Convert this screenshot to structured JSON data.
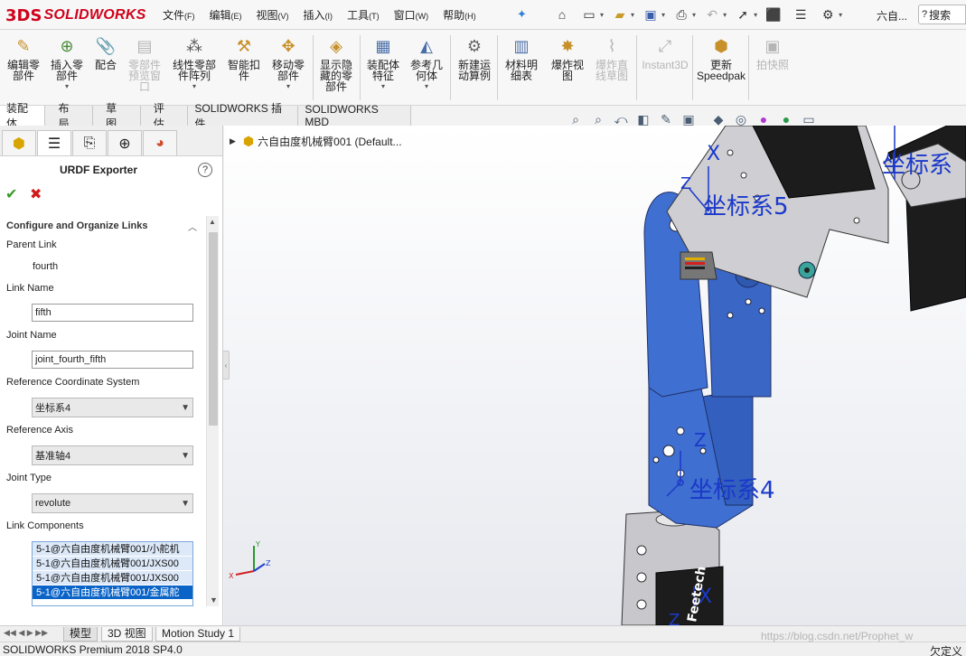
{
  "app": {
    "brand_mark": "3DS",
    "brand_name": "SOLIDWORKS",
    "document_title": "六自..."
  },
  "menus": [
    {
      "label": "文件",
      "key": "(F)"
    },
    {
      "label": "编辑",
      "key": "(E)"
    },
    {
      "label": "视图",
      "key": "(V)"
    },
    {
      "label": "插入",
      "key": "(I)"
    },
    {
      "label": "工具",
      "key": "(T)"
    },
    {
      "label": "窗口",
      "key": "(W)"
    },
    {
      "label": "帮助",
      "key": "(H)"
    }
  ],
  "search": {
    "label": "搜索"
  },
  "commands": [
    {
      "label": "编辑零\n部件",
      "icon": "edit-component-icon"
    },
    {
      "label": "插入零\n部件",
      "icon": "insert-component-icon"
    },
    {
      "label": "配合",
      "icon": "mate-icon"
    },
    {
      "label": "零部件\n预览窗\n口",
      "icon": "preview-window-icon"
    },
    {
      "label": "线性零部\n件阵列",
      "icon": "linear-pattern-icon"
    },
    {
      "label": "智能扣\n件",
      "icon": "smart-fastener-icon"
    },
    {
      "label": "移动零\n部件",
      "icon": "move-component-icon"
    },
    {
      "label": "显示隐\n藏的零\n部件",
      "icon": "show-hidden-icon"
    },
    {
      "label": "装配体\n特征",
      "icon": "assembly-feature-icon"
    },
    {
      "label": "参考几\n何体",
      "icon": "reference-geometry-icon"
    },
    {
      "label": "新建运\n动算例",
      "icon": "motion-study-icon"
    },
    {
      "label": "材料明\n细表",
      "icon": "bom-icon"
    },
    {
      "label": "爆炸视\n图",
      "icon": "exploded-view-icon"
    },
    {
      "label": "爆炸直\n线草图",
      "icon": "explode-line-icon"
    },
    {
      "label": "Instant3D",
      "icon": "instant3d-icon"
    },
    {
      "label": "更新\nSpeedpak",
      "icon": "speedpak-icon"
    },
    {
      "label": "拍快照",
      "icon": "snapshot-icon"
    }
  ],
  "tabs": [
    "装配体",
    "布局",
    "草图",
    "评估",
    "SOLIDWORKS 插件",
    "SOLIDWORKS MBD"
  ],
  "panel": {
    "title": "URDF Exporter",
    "help": "?",
    "section": "Configure and Organize Links",
    "parent_link_label": "Parent Link",
    "parent_link_value": "fourth",
    "link_name_label": "Link Name",
    "link_name_value": "fifth",
    "joint_name_label": "Joint Name",
    "joint_name_value": "joint_fourth_fifth",
    "ref_cs_label": "Reference Coordinate System",
    "ref_cs_value": "坐标系4",
    "ref_axis_label": "Reference Axis",
    "ref_axis_value": "基准轴4",
    "joint_type_label": "Joint Type",
    "joint_type_value": "revolute",
    "components_label": "Link Components",
    "components": [
      "5-1@六自由度机械臂001/小舵机",
      "5-1@六自由度机械臂001/JXS00",
      "5-1@六自由度机械臂001/JXS00",
      "5-1@六自由度机械臂001/金属舵"
    ]
  },
  "tree": {
    "root_label": "六自由度机械臂001   (Default..."
  },
  "viewport": {
    "labels": [
      "坐标系5",
      "坐标系4",
      "坐标系"
    ],
    "axes": [
      "X",
      "Z",
      "X",
      "Z",
      "X",
      "Z"
    ],
    "servo_text": "Feetech"
  },
  "triad": {
    "x": "X",
    "y": "Y",
    "z": "Z"
  },
  "bottom_tabs": [
    "模型",
    "3D 视图",
    "Motion Study 1"
  ],
  "status": {
    "left": "SOLIDWORKS Premium 2018 SP4.0",
    "right": "欠定义"
  },
  "watermark": "https://blog.csdn.net/Prophet_w",
  "colors": {
    "brand": "#d0021b",
    "part_blue": "#3f6fd0",
    "annotation_blue": "#1b39c9",
    "selection": "#0a64c8"
  }
}
